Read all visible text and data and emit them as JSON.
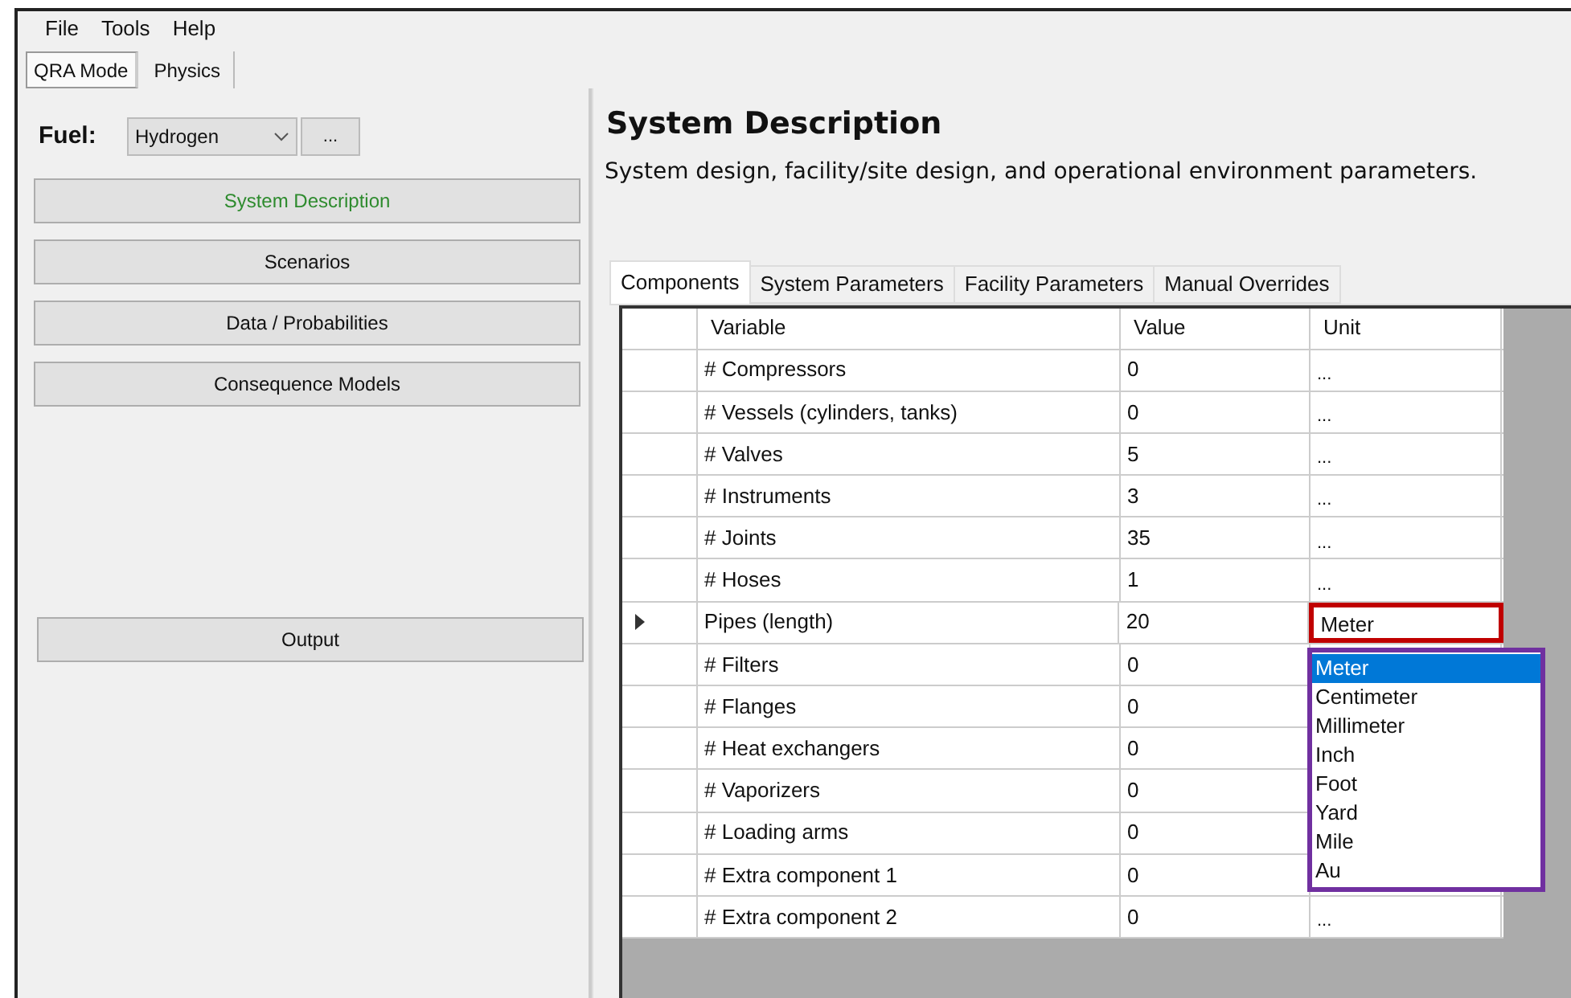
{
  "menu": [
    "File",
    "Tools",
    "Help"
  ],
  "mode_tabs": [
    {
      "label": "QRA Mode",
      "selected": true
    },
    {
      "label": "Physics",
      "selected": false
    }
  ],
  "fuel": {
    "label": "Fuel:",
    "value": "Hydrogen",
    "more": "..."
  },
  "nav_buttons": [
    {
      "label": "System Description",
      "selected": true,
      "kind": "step"
    },
    {
      "label": "Scenarios",
      "selected": false,
      "kind": "step"
    },
    {
      "label": "Data / Probabilities",
      "selected": false,
      "kind": "step"
    },
    {
      "label": "Consequence Models",
      "selected": false,
      "kind": "step"
    },
    {
      "label": "Output",
      "selected": false,
      "kind": "output"
    }
  ],
  "title": "System Description",
  "subtitle": "System design, facility/site design, and operational environment parameters.",
  "tabs": [
    {
      "label": "Components",
      "selected": true
    },
    {
      "label": "System Parameters",
      "selected": false
    },
    {
      "label": "Facility Parameters",
      "selected": false
    },
    {
      "label": "Manual Overrides",
      "selected": false
    }
  ],
  "table": {
    "columns": [
      "Variable",
      "Value",
      "Unit"
    ],
    "rows": [
      {
        "variable": "# Compressors",
        "value": "0",
        "unit": "...",
        "current": false
      },
      {
        "variable": "# Vessels (cylinders, tanks)",
        "value": "0",
        "unit": "...",
        "current": false
      },
      {
        "variable": "# Valves",
        "value": "5",
        "unit": "...",
        "current": false
      },
      {
        "variable": "# Instruments",
        "value": "3",
        "unit": "...",
        "current": false
      },
      {
        "variable": "# Joints",
        "value": "35",
        "unit": "...",
        "current": false
      },
      {
        "variable": "# Hoses",
        "value": "1",
        "unit": "...",
        "current": false
      },
      {
        "variable": "Pipes (length)",
        "value": "20",
        "unit": "Meter",
        "current": true
      },
      {
        "variable": "# Filters",
        "value": "0",
        "current": false
      },
      {
        "variable": "# Flanges",
        "value": "0",
        "current": false
      },
      {
        "variable": "# Heat exchangers",
        "value": "0",
        "current": false
      },
      {
        "variable": "# Vaporizers",
        "value": "0",
        "current": false
      },
      {
        "variable": "# Loading arms",
        "value": "0",
        "current": false
      },
      {
        "variable": "# Extra component 1",
        "value": "0",
        "current": false
      },
      {
        "variable": "# Extra component 2",
        "value": "0",
        "unit": "...",
        "current": false
      }
    ]
  },
  "unit_dropdown": [
    {
      "label": "Meter",
      "selected": true
    },
    {
      "label": "Centimeter",
      "selected": false
    },
    {
      "label": "Millimeter",
      "selected": false
    },
    {
      "label": "Inch",
      "selected": false
    },
    {
      "label": "Foot",
      "selected": false
    },
    {
      "label": "Yard",
      "selected": false
    },
    {
      "label": "Mile",
      "selected": false
    },
    {
      "label": "Au",
      "selected": false
    }
  ]
}
